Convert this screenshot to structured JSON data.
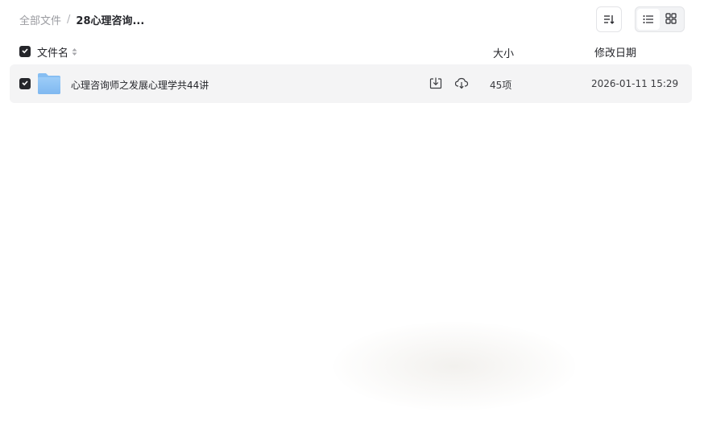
{
  "breadcrumb": {
    "root": "全部文件",
    "separator": "/",
    "current": "28心理咨询..."
  },
  "toolbar": {
    "sort_icon": "sort-lines-icon",
    "view_list_icon": "list-view-icon",
    "view_grid_icon": "grid-view-icon",
    "active_view": "list"
  },
  "table": {
    "columns": {
      "name": "文件名",
      "size": "大小",
      "date": "修改日期"
    },
    "rows": [
      {
        "checked": true,
        "icon": "folder-icon",
        "name": "心理咨询师之发展心理学共44讲",
        "size": "45项",
        "date": "2026-01-11 15:29",
        "actions": [
          "download-icon",
          "cloud-save-icon"
        ]
      }
    ]
  },
  "colors": {
    "checkbox": "#25262b",
    "row_hover": "#f4f4f5",
    "folder": "#8cc2f5",
    "muted_text": "#9a9ba0"
  }
}
